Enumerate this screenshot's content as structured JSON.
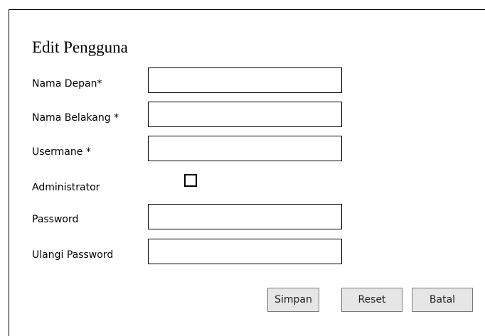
{
  "form": {
    "title": "Edit Pengguna",
    "fields": [
      {
        "label": "Nama Depan*",
        "value": ""
      },
      {
        "label": "Nama Belakang *",
        "value": ""
      },
      {
        "label": "Usermane *",
        "value": ""
      },
      {
        "label": "Administrator",
        "checked": false
      },
      {
        "label": "Password",
        "value": ""
      },
      {
        "label": "Ulangi Password",
        "value": ""
      }
    ],
    "buttons": {
      "save": "Simpan",
      "reset": "Reset",
      "cancel": "Batal"
    }
  },
  "colors": {
    "border": "#000000",
    "button_background": "#e6e6e6",
    "button_border": "#7a7a7a"
  }
}
